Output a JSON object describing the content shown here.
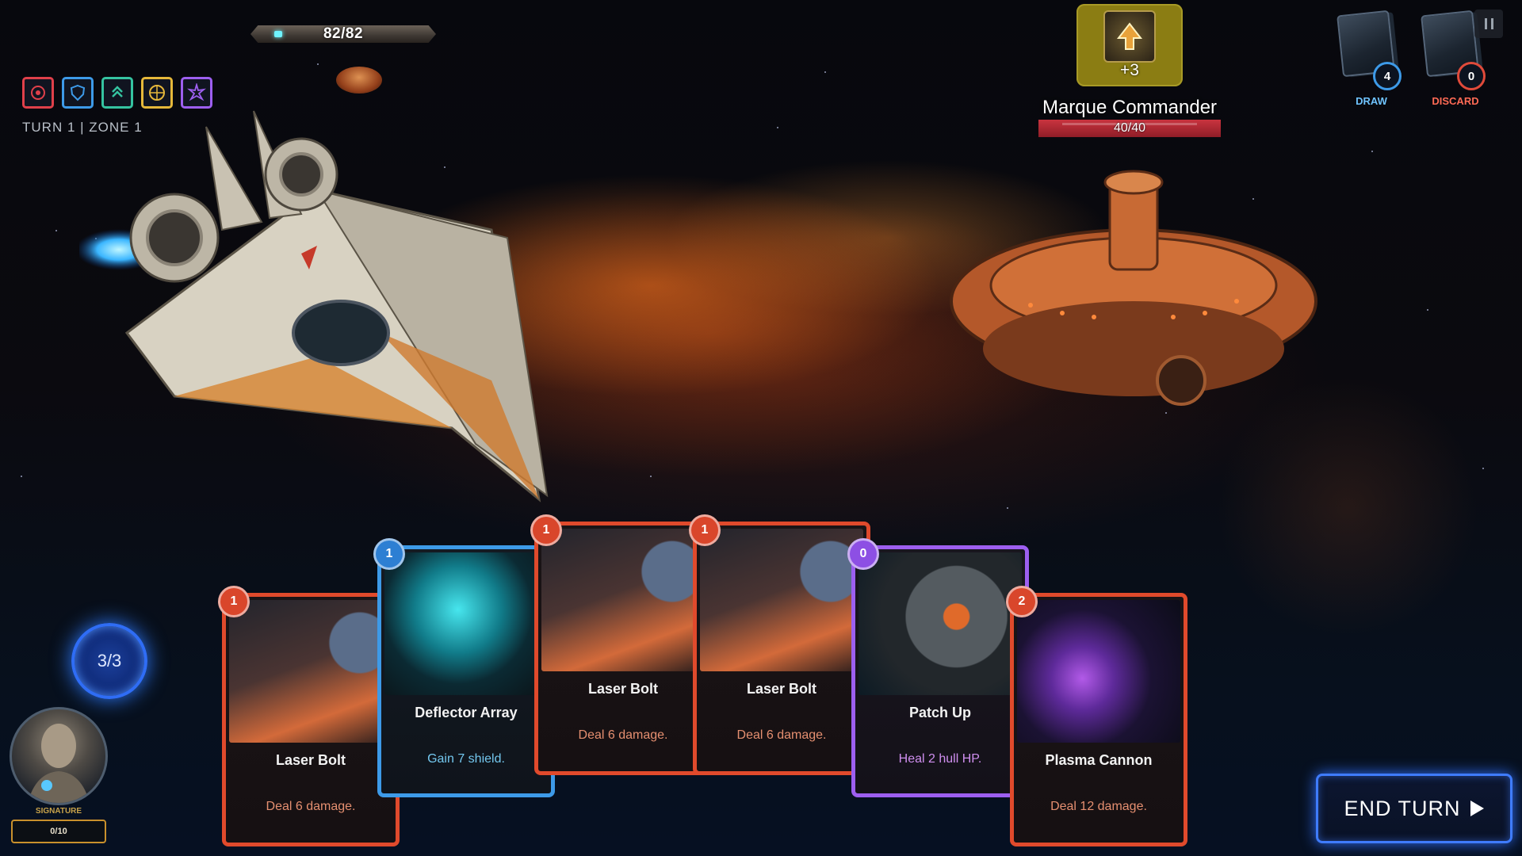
{
  "player": {
    "hp_text": "82/82",
    "turn_label": "TURN 1 | ZONE 1",
    "energy_text": "3/3",
    "signature_label": "SIGNATURE",
    "signature_value": "0/10",
    "status_icons": [
      {
        "name": "target-icon",
        "color": "#e0404a"
      },
      {
        "name": "shield-icon",
        "color": "#3d9ae8"
      },
      {
        "name": "chevrons-up-icon",
        "color": "#35c3a0"
      },
      {
        "name": "radar-icon",
        "color": "#e6b83a"
      },
      {
        "name": "burst-icon",
        "color": "#9d5ff0"
      }
    ]
  },
  "enemy": {
    "name": "Marque Commander",
    "hp_text": "40/40",
    "intent_value": "+3",
    "intent_icon": "arrow-up-icon"
  },
  "piles": {
    "draw_label": "DRAW",
    "draw_count": "4",
    "discard_label": "DISCARD",
    "discard_count": "0"
  },
  "hand": [
    {
      "cost": "1",
      "name": "Laser Bolt",
      "desc": "Deal 6 damage.",
      "type": "red"
    },
    {
      "cost": "1",
      "name": "Deflector Array",
      "desc": "Gain 7 shield.",
      "type": "blue"
    },
    {
      "cost": "1",
      "name": "Laser Bolt",
      "desc": "Deal 6 damage.",
      "type": "red"
    },
    {
      "cost": "1",
      "name": "Laser Bolt",
      "desc": "Deal 6 damage.",
      "type": "red"
    },
    {
      "cost": "0",
      "name": "Patch Up",
      "desc": "Heal 2 hull HP.",
      "type": "purple"
    },
    {
      "cost": "2",
      "name": "Plasma Cannon",
      "desc": "Deal 12 damage.",
      "type": "red"
    }
  ],
  "end_turn_label": "END TURN",
  "pause_icon": "pause-icon"
}
